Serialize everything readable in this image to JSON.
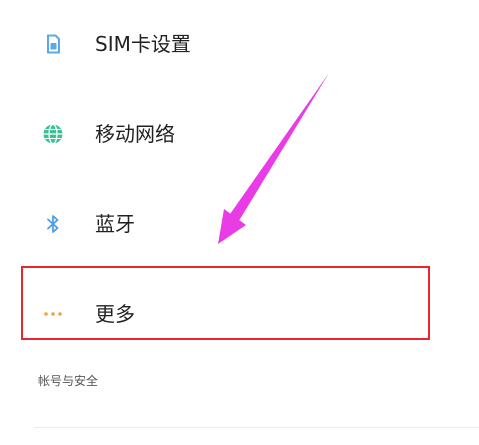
{
  "settings": {
    "items": [
      {
        "label": "SIM卡设置",
        "icon": "sim-card-icon"
      },
      {
        "label": "移动网络",
        "icon": "globe-icon"
      },
      {
        "label": "蓝牙",
        "icon": "bluetooth-icon"
      },
      {
        "label": "更多",
        "icon": "more-dots-icon"
      }
    ],
    "section_header": "帐号与安全"
  },
  "colors": {
    "sim_icon": "#5ba8ea",
    "network_icon": "#3dbf93",
    "bluetooth_icon": "#4a9fe8",
    "more_icon": "#f3a246",
    "highlight_box": "#e8262d",
    "annotation_arrow": "#e93ce6"
  }
}
